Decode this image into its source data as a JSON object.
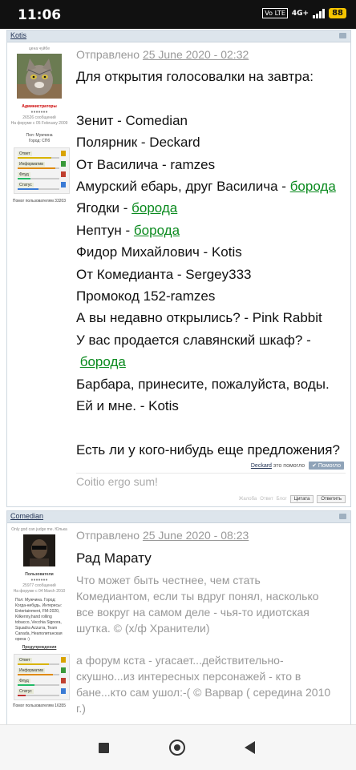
{
  "status_bar": {
    "time": "11:06",
    "volte": "Vo LTE",
    "network": "4G+",
    "battery": "88"
  },
  "post1": {
    "author": "Kotis",
    "user_title": "цена чуйбе",
    "rank": "Администраторы",
    "posts": "26526 сообщений",
    "joined": "На форуме с 05 February 2009",
    "gender": "Пол: Мужчина",
    "city": "Город: СПб",
    "stat_labels": [
      "Ответ",
      "Информатив",
      "Флуд",
      "Статус"
    ],
    "helped": "Помог пользователям 33203",
    "sent_label": "Отправлено",
    "date": "25 June 2020 - 02:32",
    "lines": [
      {
        "text": "Для открытия голосовалки на завтра:"
      },
      {
        "text": ""
      },
      {
        "text": "Зенит - Comedian"
      },
      {
        "text": "Полярник - Deckard"
      },
      {
        "text": "От Василича - ramzes"
      },
      {
        "text": "Амурский ебарь, друг Василича - ",
        "link": "борода"
      },
      {
        "text": "Ягодки - ",
        "link": "борода"
      },
      {
        "text": "Нептун - ",
        "link": "борода"
      },
      {
        "text": "Фидор Михайлович - Kotis"
      },
      {
        "text": "От Комедианта - Sergey333"
      },
      {
        "text": "Промокод 152-ramzes"
      },
      {
        "text": "А вы недавно открылись? - Pink Rabbit"
      },
      {
        "text": "У вас продается славянский шкаф? -"
      },
      {
        "text": "",
        "link": "борода"
      },
      {
        "text": "Барбара, принесите, пожалуйста, воды."
      },
      {
        "text": "Ей и мне. - Kotis"
      },
      {
        "text": ""
      },
      {
        "text": "Есть ли у кого-нибудь еще предложения?"
      }
    ],
    "thanks_user": "Deckard",
    "thanks_text": "это помогло",
    "thanks_button": "✔ Помогло",
    "signature": "Coitio ergo sum!",
    "actions": [
      "Жалоба",
      "Ответ",
      "Блог",
      "Цитата",
      "Ответить"
    ]
  },
  "post2": {
    "author": "Comedian",
    "user_title": "Only god can judge me. Юлька",
    "rank": "Пользователи",
    "posts": "25977 сообщений",
    "joined": "На форуме с 04 March 2010",
    "profile_info": "Пол: Мужчина. Город: Когда-нибудь. Интересы: Entertainment, FM-2020, Kilkenny,hand rolling tobacco, Vecchia Signora, Squadra Azzurra, Team Canada, Неаполитанская ореха :)",
    "warnings": "Предупреждения",
    "stat_labels": [
      "Ответ",
      "Информатив",
      "Флуд",
      "Статус"
    ],
    "helped": "Помог пользователям 16355",
    "sent_label": "Отправлено",
    "date": "25 June 2020 - 08:23",
    "title_line": "Рад Марату",
    "quote_lines": [
      "Что может быть честнее, чем стать",
      "Комедиантом, если ты вдруг понял, насколько",
      "все вокруг на самом деле - чья-то идиотская",
      "шутка. © (х/ф Хранители)",
      "",
      "а форум кста - угасает...действительно-",
      "скушно...из интересных персонажей - кто в",
      "бане...кто сам ушол:-( © Варвар ( середина 2010",
      "г.)"
    ]
  },
  "colors": {
    "link": "#0a8a1e",
    "header_bg": "#dde5ec",
    "rank_admin": "#c00000"
  },
  "icons": [
    "square-nav-icon",
    "home-circle-icon",
    "back-triangle-icon",
    "shield-icon",
    "star-icon"
  ]
}
